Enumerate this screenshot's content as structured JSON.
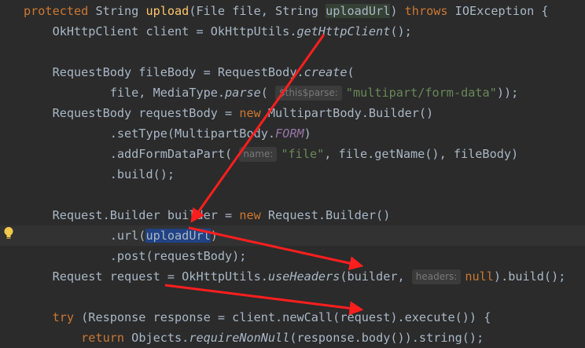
{
  "code": {
    "l1": {
      "kw1": "protected",
      "t1": " String ",
      "fn": "upload",
      "t2": "(File file, String ",
      "param": "uploadUrl",
      "t3": ") ",
      "kw2": "throws",
      "t4": " IOException {"
    },
    "l2": {
      "t1": "    OkHttpClient client = OkHttpUtils.",
      "it": "getHttpClient",
      "t2": "();"
    },
    "l4": {
      "t1": "    RequestBody fileBody = RequestBody.",
      "it": "create",
      "t2": "("
    },
    "l5": {
      "t1": "            file, MediaType.",
      "it": "parse",
      "t2": "( ",
      "hint": "$this$parse:",
      "str": "\"multipart/form-data\"",
      "t3": "));"
    },
    "l6": {
      "t1": "    RequestBody requestBody = ",
      "kw": "new",
      "t2": " MultipartBody.Builder()"
    },
    "l7": {
      "t1": "            .setType(MultipartBody.",
      "cn": "FORM",
      "t2": ")"
    },
    "l8": {
      "t1": "            .addFormDataPart( ",
      "hint": "name:",
      "str": "\"file\"",
      "t2": ", file.getName(), fileBody)"
    },
    "l9": {
      "t1": "            .build();"
    },
    "l11": {
      "t1": "    Request.Builder builder = ",
      "kw": "new",
      "t2": " Request.Builder()"
    },
    "l12": {
      "t1": "            .url(",
      "sel": "uploadUrl",
      "t2": ")"
    },
    "l13": {
      "t1": "            .post(requestBody);"
    },
    "l14": {
      "t1": "    Request request = OkHttpUtils.",
      "it": "useHeaders",
      "t2": "(builder, ",
      "hint": "headers:",
      "kw": "null",
      "t3": ").build();"
    },
    "l16": {
      "kw": "try",
      "t1": " (Response response = client.newCall(request).execute()) {",
      "pre": "    "
    },
    "l17": {
      "pre": "        ",
      "kw": "return",
      "t1": " Objects.",
      "it": "requireNonNull",
      "t2": "(response.body()).string();"
    }
  },
  "colors": {
    "background": "#2b2b2b",
    "keyword": "#cc7832",
    "function": "#ffc66d",
    "string": "#6a8759",
    "constant": "#9876aa",
    "arrow": "#ff1e1e"
  },
  "icons": {
    "gutter": "lightbulb-icon"
  }
}
